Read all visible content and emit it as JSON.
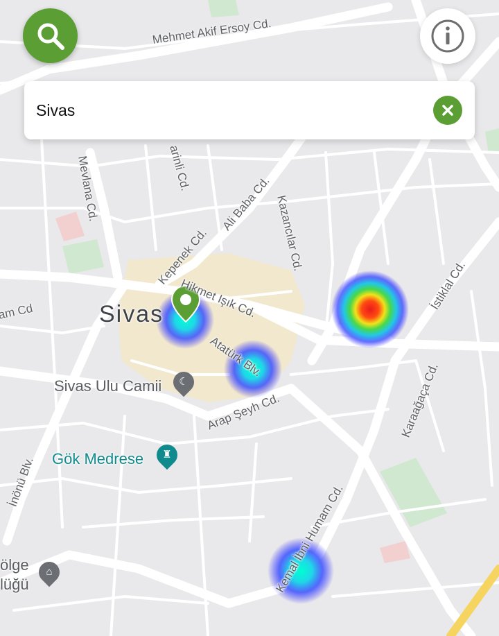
{
  "search": {
    "value": "Sivas",
    "placeholder": ""
  },
  "colors": {
    "accent": "#5a9e34",
    "map_bg": "#e9e9eb",
    "road": "#ffffff",
    "poi_teal": "#0f8b8d",
    "heat_hot": "#e8231e",
    "heat_cool": "#2a3bff"
  },
  "icons": {
    "search": "search-icon",
    "info": "info-icon",
    "clear": "close-icon",
    "pin": "map-pin-icon",
    "mosque": "mosque-icon",
    "tower": "tower-icon",
    "museum": "museum-icon"
  },
  "map": {
    "city_label": "Sivas",
    "streets": {
      "mehmet_akif_ersoy": "Mehmet Akif Ersoy Cd.",
      "mevlana": "Mevlana Cd.",
      "arinli": "arinli Cd.",
      "ali_baba": "Ali Baba Cd.",
      "kazancilar": "Kazancılar Cd.",
      "kepenek": "Kepenek Cd.",
      "hikmet_isik": "Hikmet Işık Cd.",
      "ataturk": "Atatürk Blv.",
      "arap_seyh": "Arap Şeyh Cd.",
      "istiklal": "İstiklal Cd.",
      "karaagaca": "Karaağaça Cd.",
      "inonu": "İnönü Blv.",
      "kemal_ibni_humam": "Kemal İbni Humam Cd.",
      "am_cd": "am Cd"
    },
    "pois": {
      "ulu_camii": "Sivas Ulu Camii",
      "gok_medrese": "Gök Medrese",
      "bolge_line1": "ölge",
      "bolge_line2": "lüğü"
    },
    "heatmap_points": [
      {
        "name": "center-pin-cluster",
        "intensity": 0.3
      },
      {
        "name": "ataturk-cluster",
        "intensity": 0.3
      },
      {
        "name": "east-cluster",
        "intensity": 1.0
      },
      {
        "name": "south-cluster",
        "intensity": 0.25
      }
    ]
  }
}
